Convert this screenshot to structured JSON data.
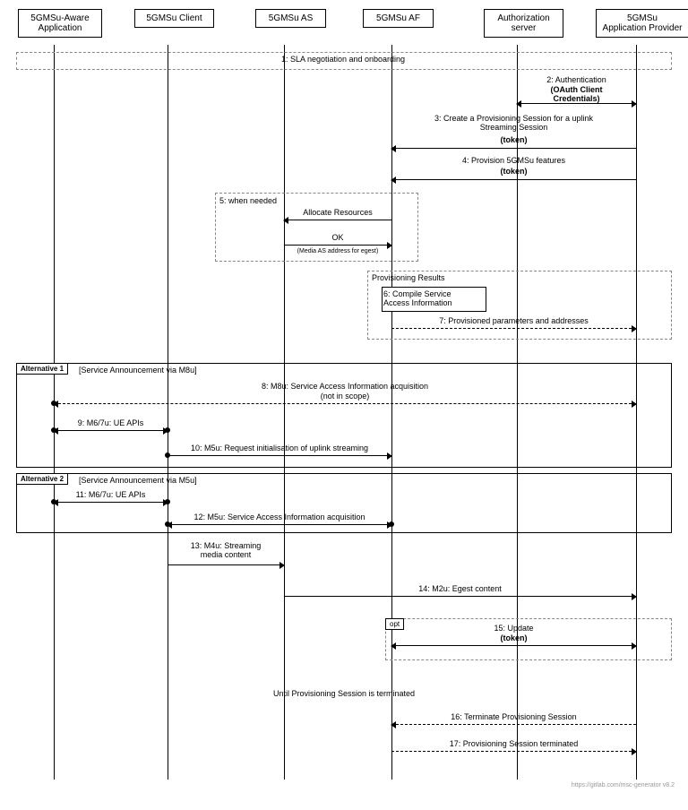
{
  "participants": {
    "p1": "5GMSu-Aware\nApplication",
    "p2": "5GMSu Client",
    "p3": "5GMSu AS",
    "p4": "5GMSu AF",
    "p5": "Authorization\nserver",
    "p6": "5GMSu\nApplication Provider"
  },
  "messages": {
    "m1": "1: SLA negotiation and onboarding",
    "m2": "2: Authentication",
    "m2b": "(OAuth Client\nCredentials)",
    "m3": "3: Create a Provisioning Session for a uplink\nStreaming Session",
    "m3b": "(token)",
    "m4": "4: Provision 5GMSu features",
    "m4b": "(token)",
    "box5": "5: when needed",
    "m5a": "Allocate Resources",
    "m5b": "OK",
    "m5c": "(Media AS address for egest)",
    "box6": "Provisioning Results",
    "m6": "6: Compile Service\nAccess Information",
    "m7": "7: Provisioned parameters and addresses",
    "alt1": "Alternative 1",
    "alt1cond": "[Service Announcement via M8u]",
    "m8": "8: M8u: Service Access Information acquisition",
    "m8b": "(not in scope)",
    "m9": "9: M6/7u: UE APIs",
    "m10": "10: M5u: Request initialisation of uplink streaming",
    "alt2": "Alternative 2",
    "alt2cond": "[Service Announcement via M5u]",
    "m11": "11: M6/7u: UE APIs",
    "m12": "12: M5u: Service Access Information acquisition",
    "m13": "13: M4u: Streaming\nmedia content",
    "m14": "14: M2u: Egest content",
    "opt": "opt",
    "m15": "15: Update",
    "m15b": "(token)",
    "until": "Until Provisioning Session is terminated",
    "m16": "16: Terminate Provisioning Session",
    "m17": "17: Provisioning Session terminated"
  },
  "footer": "https://gitlab.com/msc-generator v8.2"
}
